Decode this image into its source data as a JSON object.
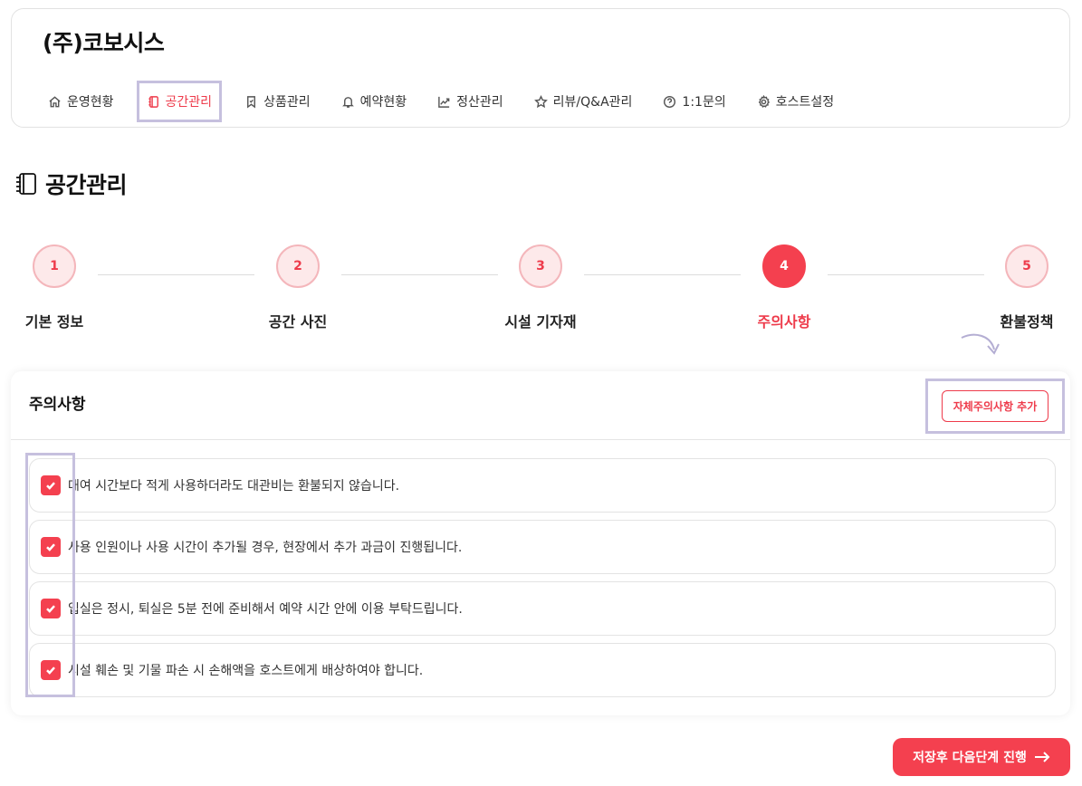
{
  "header": {
    "company_name": "(주)코보시스",
    "nav": [
      {
        "label": "운영현황",
        "icon": "home-icon"
      },
      {
        "label": "공간관리",
        "icon": "notebook-icon",
        "active": true
      },
      {
        "label": "상품관리",
        "icon": "bookmark-icon"
      },
      {
        "label": "예약현황",
        "icon": "bell-icon"
      },
      {
        "label": "정산관리",
        "icon": "trend-chart-icon"
      },
      {
        "label": "리뷰/Q&A관리",
        "icon": "star-icon"
      },
      {
        "label": "1:1문의",
        "icon": "question-circle-icon"
      },
      {
        "label": "호스트설정",
        "icon": "gear-icon"
      }
    ]
  },
  "page": {
    "title": "공간관리",
    "title_icon": "notebook-icon"
  },
  "stepper": {
    "steps": [
      {
        "number": "1",
        "label": "기본 정보"
      },
      {
        "number": "2",
        "label": "공간 사진"
      },
      {
        "number": "3",
        "label": "시설 기자재"
      },
      {
        "number": "4",
        "label": "주의사항",
        "active": true
      },
      {
        "number": "5",
        "label": "환불정책"
      }
    ]
  },
  "notices": {
    "title": "주의사항",
    "add_button": "자체주의사항 추가",
    "items": [
      {
        "text": "대여 시간보다 적게 사용하더라도 대관비는 환불되지 않습니다.",
        "checked": true
      },
      {
        "text": "사용 인원이나 사용 시간이 추가될 경우, 현장에서 추가 과금이 진행됩니다.",
        "checked": true
      },
      {
        "text": "입실은 정시, 퇴실은 5분 전에 준비해서 예약 시간 안에 이용 부탁드립니다.",
        "checked": true
      },
      {
        "text": "시설 훼손 및 기물 파손 시 손해액을 호스트에게 배상하여야 합니다.",
        "checked": true
      }
    ]
  },
  "footer": {
    "next_button": "저장후 다음단계 진행"
  },
  "colors": {
    "accent": "#f4404f",
    "highlight": "#c6c0de"
  }
}
